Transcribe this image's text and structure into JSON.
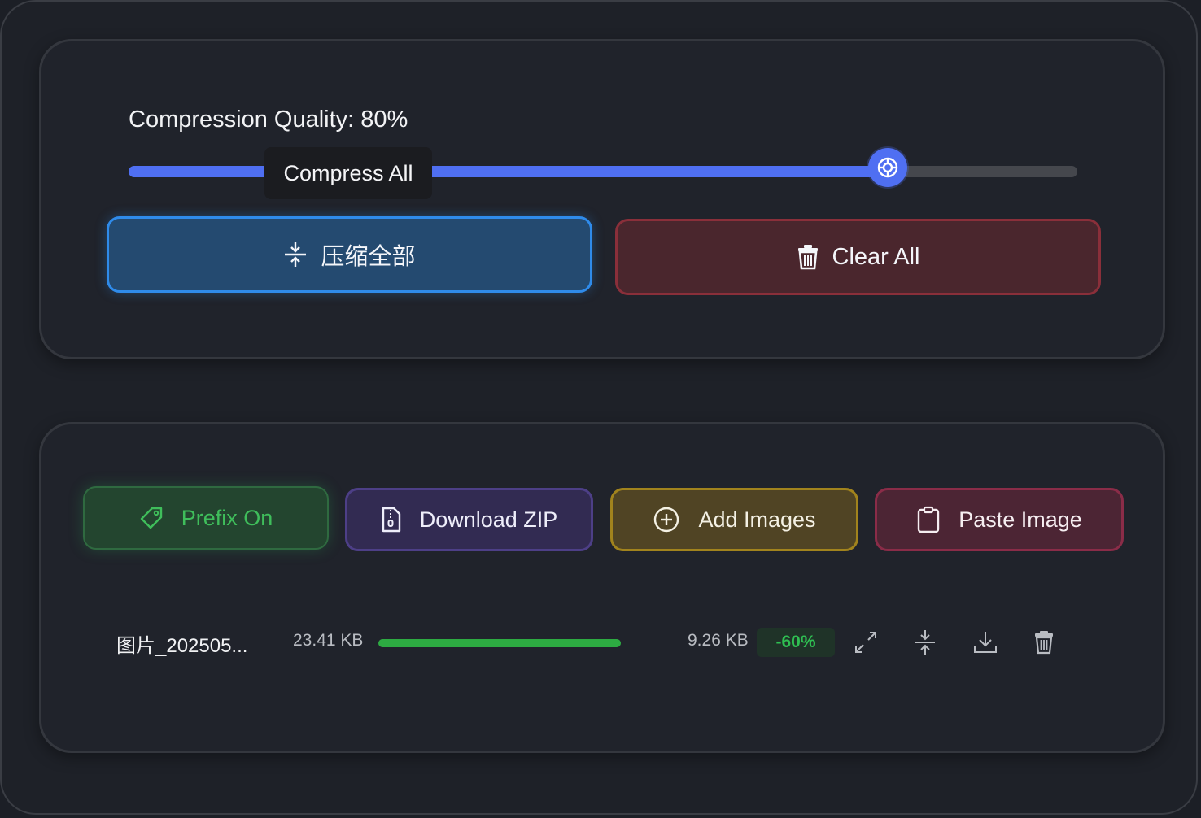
{
  "settings": {
    "quality_label": "Compression Quality: 80%",
    "quality_value": 80,
    "tooltip": "Compress All",
    "compress_all_label": "压缩全部",
    "clear_all_label": "Clear All"
  },
  "toolbar": {
    "prefix_label": "Prefix On",
    "download_zip_label": "Download ZIP",
    "add_images_label": "Add Images",
    "paste_image_label": "Paste Image"
  },
  "files": [
    {
      "name": "图片_202505...",
      "original_size": "23.41 KB",
      "progress": 1.0,
      "compressed_size": "9.26 KB",
      "ratio": "-60%"
    }
  ],
  "colors": {
    "accent": "#4f6ff2",
    "compress": "#2f8bea",
    "danger": "#8a2f3a",
    "success": "#2fbf52",
    "zip": "#4d3f87",
    "add": "#a1831d",
    "paste": "#8a2c48"
  },
  "icons": {
    "compress": "compress-icon",
    "trash": "trash-icon",
    "tag": "tag-icon",
    "zip": "zip-file-icon",
    "add": "plus-circle-icon",
    "paste": "clipboard-icon",
    "expand": "expand-icon",
    "download": "download-icon"
  }
}
